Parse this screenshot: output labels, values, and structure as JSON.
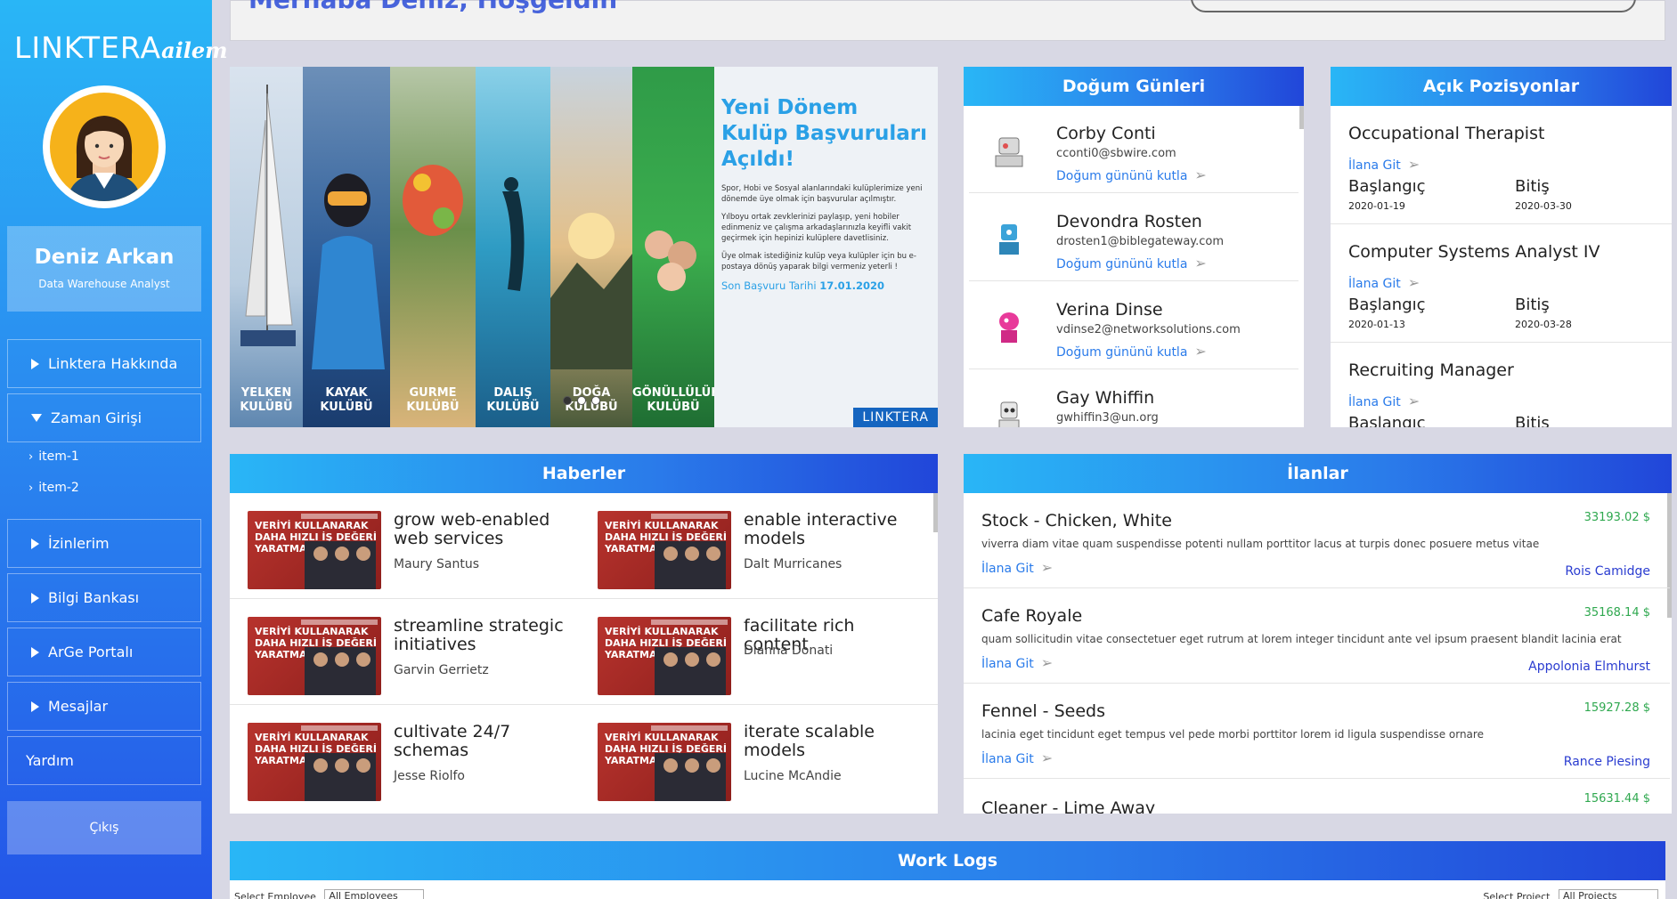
{
  "brand": {
    "name": "LINKTERA",
    "suffix": "ailem"
  },
  "profile": {
    "name": "Deniz Arkan",
    "role": "Data Warehouse Analyst"
  },
  "sidebar": {
    "items": [
      {
        "label": "Linktera Hakkında"
      },
      {
        "label": "Zaman Girişi"
      },
      {
        "label": "item-1"
      },
      {
        "label": "item-2"
      },
      {
        "label": "İzinlerim"
      },
      {
        "label": "Bilgi Bankası"
      },
      {
        "label": "ArGe Portalı"
      },
      {
        "label": "Mesajlar"
      },
      {
        "label": "Yardım"
      }
    ],
    "logout": "Çıkış"
  },
  "header": {
    "greeting": "Merhaba Deniz, Hoşgeldin"
  },
  "banner": {
    "strips": [
      {
        "label1": "YELKEN",
        "label2": "KULÜBÜ",
        "color": "#6a8fb5"
      },
      {
        "label1": "KAYAK",
        "label2": "KULÜBÜ",
        "color": "#3a6fa8"
      },
      {
        "label1": "GURME",
        "label2": "KULÜBÜ",
        "color": "#4d7a3a"
      },
      {
        "label1": "DALIŞ",
        "label2": "KULÜBÜ",
        "color": "#2e8fa7"
      },
      {
        "label1": "DOĞA",
        "label2": "KULÜBÜ",
        "color": "#a87a3a"
      },
      {
        "label1": "GÖNÜLLÜLÜK",
        "label2": "KULÜBÜ",
        "color": "#2f8f45"
      }
    ],
    "promo_title_1": "Yeni Dönem",
    "promo_title_2": "Kulüp Başvuruları",
    "promo_title_3": "Açıldı!",
    "promo_p1": "Spor, Hobi ve Sosyal alanlarındaki kulüplerimize yeni dönemde üye olmak için başvurular açılmıştır.",
    "promo_p2": "Yılboyu ortak zevklerinizi paylaşıp, yeni hobiler edinmeniz ve çalışma arkadaşlarınızla keyifli vakit geçirmek için hepinizi kulüplere davetlisiniz.",
    "promo_p3": "Üye olmak istediğiniz kulüp veya kulüpler için bu e-postaya dönüş yaparak bilgi vermeniz yeterli !",
    "deadline_label": "Son Başvuru Tarihi",
    "deadline_date": "17.01.2020",
    "brand": "LINKTERA"
  },
  "birthdays": {
    "title": "Doğum Günleri",
    "action": "Doğum gününü kutla",
    "people": [
      {
        "name": "Corby Conti",
        "email": "cconti0@sbwire.com"
      },
      {
        "name": "Devondra Rosten",
        "email": "drosten1@biblegateway.com"
      },
      {
        "name": "Verina Dinse",
        "email": "vdinse2@networksolutions.com"
      },
      {
        "name": "Gay Whiffin",
        "email": "gwhiffin3@un.org"
      }
    ]
  },
  "positions": {
    "title": "Açık Pozisyonlar",
    "link": "İlana Git",
    "start_label": "Başlangıç",
    "end_label": "Bitiş",
    "items": [
      {
        "title": "Occupational Therapist",
        "start": "2020-01-19",
        "end": "2020-03-30"
      },
      {
        "title": "Computer Systems Analyst IV",
        "start": "2020-01-13",
        "end": "2020-03-28"
      },
      {
        "title": "Recruiting Manager",
        "start": "",
        "end": ""
      }
    ]
  },
  "news": {
    "title": "Haberler",
    "thumb_text": "VERİYİ KULLANARAK DAHA HIZLI İŞ DEĞERİ YARATMAK",
    "items": [
      {
        "title": "grow web-enabled web services",
        "author": "Maury Santus"
      },
      {
        "title": "enable interactive models",
        "author": "Dalt Murricanes"
      },
      {
        "title": "streamline strategic initiatives",
        "author": "Garvin Gerrietz"
      },
      {
        "title": "facilitate rich content",
        "author": "Dianna Donati"
      },
      {
        "title": "cultivate 24/7 schemas",
        "author": "Jesse Riolfo"
      },
      {
        "title": "iterate scalable models",
        "author": "Lucine McAndie"
      }
    ]
  },
  "ads": {
    "title": "İlanlar",
    "link": "İlana Git",
    "items": [
      {
        "title": "Stock - Chicken, White",
        "price": "33193.02 $",
        "desc": "viverra diam vitae quam suspendisse potenti nullam porttitor lacus at turpis donec posuere metus vitae",
        "owner": "Rois Camidge"
      },
      {
        "title": "Cafe Royale",
        "price": "35168.14 $",
        "desc": "quam sollicitudin vitae consectetuer eget rutrum at lorem integer tincidunt ante vel ipsum praesent blandit lacinia erat",
        "owner": "Appolonia Elmhurst"
      },
      {
        "title": "Fennel - Seeds",
        "price": "15927.28 $",
        "desc": "lacinia eget tincidunt eget tempus vel pede morbi porttitor lorem id ligula suspendisse ornare",
        "owner": "Rance Piesing"
      },
      {
        "title": "Cleaner - Lime Away",
        "price": "15631.44 $",
        "desc": "",
        "owner": ""
      }
    ]
  },
  "worklogs": {
    "title": "Work Logs",
    "employee_label": "Select Employee",
    "employee_value": "All Employees",
    "project_label": "Select Project",
    "project_value": "All Projects"
  }
}
